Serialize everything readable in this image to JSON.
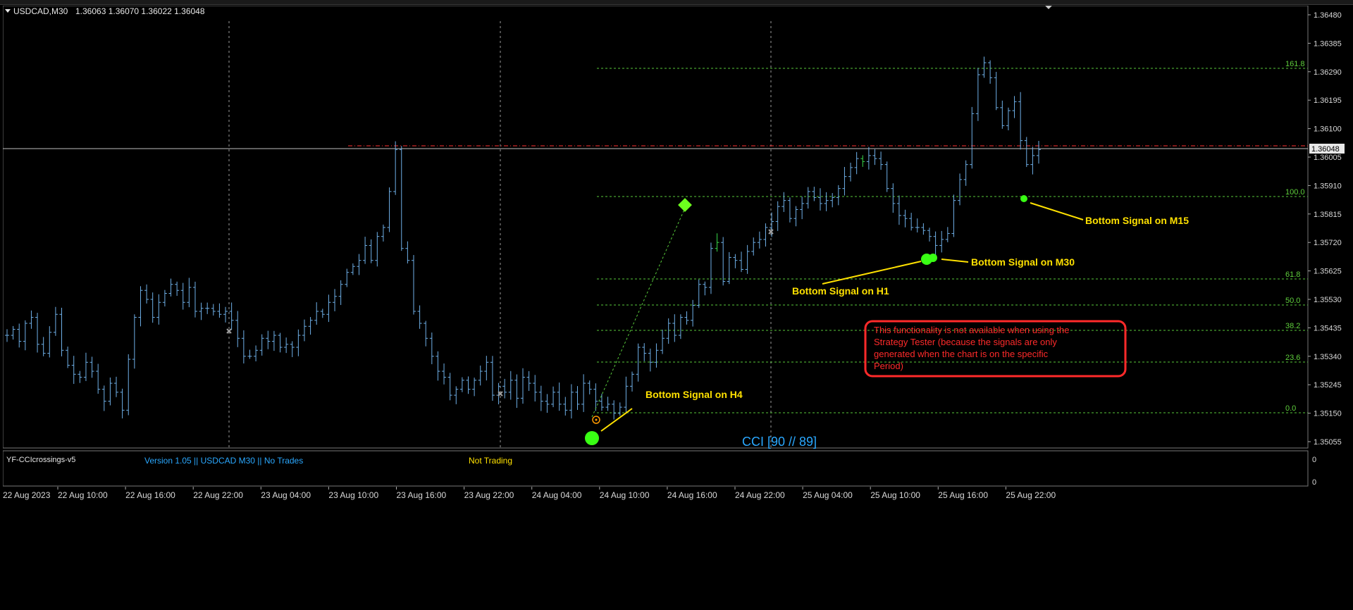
{
  "chart": {
    "symbol_label": "USDCAD,M30",
    "ohlc": "1.36063 1.36070 1.36022 1.36048",
    "current_price": "1.36048",
    "colors": {
      "background": "#000000",
      "bars": "#6fb0e8",
      "fibo": "#57c83a",
      "annotation": "#ffe100",
      "signal": "#39ff14",
      "warning": "#ff2a2a",
      "cci_text": "#2aa8ff",
      "bid_line": "#c0c0c0",
      "ask_line": "#ff3030"
    }
  },
  "price_axis": [
    "1.36480",
    "1.36385",
    "1.36290",
    "1.36195",
    "1.36100",
    "1.36005",
    "1.35910",
    "1.35815",
    "1.35720",
    "1.35625",
    "1.35530",
    "1.35435",
    "1.35340",
    "1.35245",
    "1.35150",
    "1.35055"
  ],
  "time_axis": [
    "22 Aug 2023",
    "22 Aug 10:00",
    "22 Aug 16:00",
    "22 Aug 22:00",
    "23 Aug 04:00",
    "23 Aug 10:00",
    "23 Aug 16:00",
    "23 Aug 22:00",
    "24 Aug 04:00",
    "24 Aug 10:00",
    "24 Aug 16:00",
    "24 Aug 22:00",
    "25 Aug 04:00",
    "25 Aug 10:00",
    "25 Aug 16:00",
    "25 Aug 22:00"
  ],
  "fibo_levels": [
    "161.8",
    "100.0",
    "61.8",
    "50.0",
    "38.2",
    "23.6",
    "0.0"
  ],
  "annotations": {
    "h4": "Bottom Signal on H4",
    "h1": "Bottom Signal on H1",
    "m30": "Bottom Signal on M30",
    "m15": "Bottom Signal on M15"
  },
  "warning_lines": [
    "This functionality is not available when using the",
    "Strategy Tester (because the signals are only",
    "generated when the chart is on the specific",
    "Period)"
  ],
  "cci_label": "CCI [90 // 89]",
  "indicator": {
    "name": "YF-CCIcrossings-v5",
    "version_text": "Version 1.05 || USDCAD M30 || No Trades",
    "status_text": "Not Trading",
    "axis_top": "0",
    "axis_bottom": "0"
  },
  "chart_data": {
    "type": "ohlc",
    "series": [
      {
        "name": "USDCAD,M30"
      }
    ],
    "closes": [
      1.3541,
      1.3543,
      1.3539,
      1.3545,
      1.3547,
      1.3538,
      1.3535,
      1.3542,
      1.3548,
      1.3536,
      1.3531,
      1.3528,
      1.3527,
      1.3532,
      1.3529,
      1.3523,
      1.3519,
      1.3525,
      1.3522,
      1.3516,
      1.3533,
      1.3547,
      1.3556,
      1.3553,
      1.3547,
      1.3552,
      1.3555,
      1.3558,
      1.3556,
      1.3552,
      1.3557,
      1.3549,
      1.355,
      1.355,
      1.3549,
      1.3548,
      1.3549,
      1.3546,
      1.354,
      1.3534,
      1.3534,
      1.3536,
      1.354,
      1.3539,
      1.3541,
      1.3537,
      1.3538,
      1.3537,
      1.3541,
      1.3544,
      1.3546,
      1.3549,
      1.3548,
      1.3552,
      1.3554,
      1.3558,
      1.3562,
      1.3564,
      1.3566,
      1.3571,
      1.3566,
      1.3574,
      1.3577,
      1.3589,
      1.3603,
      1.357,
      1.3566,
      1.3549,
      1.3545,
      1.354,
      1.3534,
      1.3529,
      1.3527,
      1.3521,
      1.3523,
      1.3526,
      1.3523,
      1.3526,
      1.3529,
      1.3532,
      1.3521,
      1.3524,
      1.3522,
      1.3526,
      1.352,
      1.3527,
      1.3525,
      1.3522,
      1.3519,
      1.3518,
      1.3522,
      1.3518,
      1.3516,
      1.3522,
      1.3518,
      1.3525,
      1.3523,
      1.3519,
      1.3517,
      1.3518,
      1.3515,
      1.3517,
      1.3524,
      1.3528,
      1.3537,
      1.3535,
      1.3532,
      1.3536,
      1.354,
      1.3545,
      1.3541,
      1.3547,
      1.3546,
      1.3551,
      1.3558,
      1.3557,
      1.357,
      1.3572,
      1.3559,
      1.3567,
      1.3566,
      1.3563,
      1.3569,
      1.3572,
      1.3573,
      1.3577,
      1.3579,
      1.3584,
      1.3586,
      1.358,
      1.3583,
      1.3585,
      1.3589,
      1.3587,
      1.3585,
      1.3586,
      1.3587,
      1.359,
      1.3594,
      1.3597,
      1.36,
      1.3599,
      1.3601,
      1.36,
      1.3598,
      1.359,
      1.3585,
      1.3581,
      1.358,
      1.3577,
      1.3577,
      1.3576,
      1.3574,
      1.3571,
      1.3573,
      1.3575,
      1.3586,
      1.3593,
      1.3598,
      1.3615,
      1.3628,
      1.3632,
      1.3627,
      1.3617,
      1.3611,
      1.3616,
      1.3619,
      1.3606,
      1.3598,
      1.3601,
      1.3603
    ]
  }
}
